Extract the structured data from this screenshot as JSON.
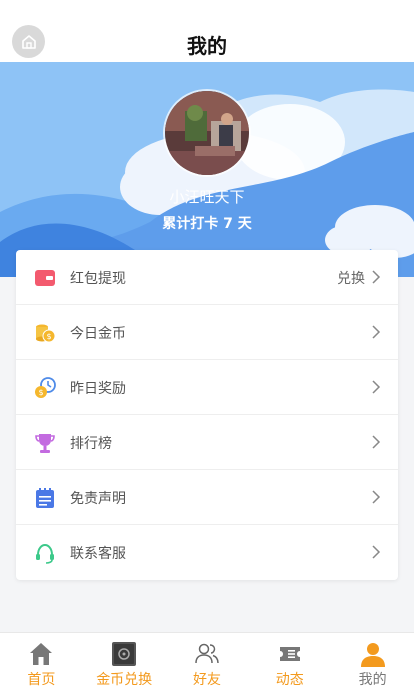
{
  "header": {
    "title": "我的"
  },
  "profile": {
    "username": "小汪旺天下",
    "checkin_text": "累计打卡 7 天"
  },
  "menu": {
    "items": [
      {
        "label": "红包提现",
        "extra": "兑换",
        "icon": "red-envelope-icon"
      },
      {
        "label": "今日金币",
        "icon": "gold-coins-icon"
      },
      {
        "label": "昨日奖励",
        "icon": "coin-clock-icon"
      },
      {
        "label": "排行榜",
        "icon": "trophy-icon"
      },
      {
        "label": "免责声明",
        "icon": "notepad-icon"
      },
      {
        "label": "联系客服",
        "icon": "headset-icon"
      }
    ]
  },
  "tabbar": {
    "items": [
      {
        "label": "首页",
        "icon": "house-icon",
        "color": "#f39a1e"
      },
      {
        "label": "金币兑换",
        "icon": "safe-icon",
        "color": "#f39a1e"
      },
      {
        "label": "好友",
        "icon": "friends-icon",
        "color": "#f39a1e"
      },
      {
        "label": "动态",
        "icon": "ticket-icon",
        "color": "#f39a1e"
      },
      {
        "label": "我的",
        "icon": "user-icon",
        "color": "#777777",
        "active_icon_color": "#f39a1e"
      }
    ]
  },
  "colors": {
    "banner_blue": "#8ec3f6",
    "accent_orange": "#f39a1e"
  }
}
